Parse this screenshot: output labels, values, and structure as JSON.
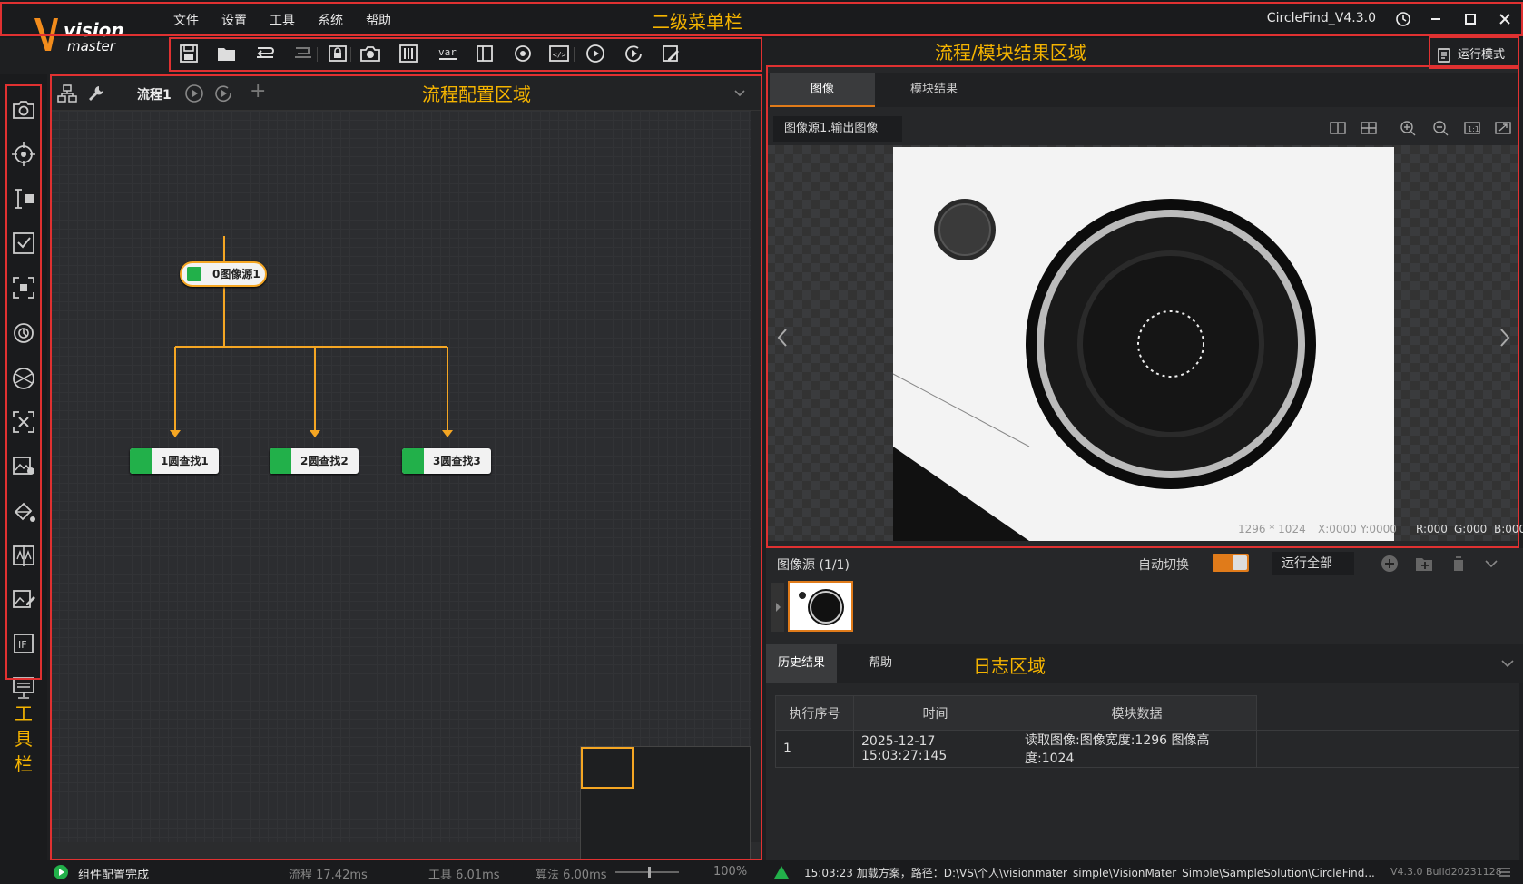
{
  "menu": [
    "文件",
    "设置",
    "工具",
    "系统",
    "帮助"
  ],
  "app_title": "CircleFind_V4.3.0",
  "annotations": {
    "secondary_menu": "二级菜单栏",
    "flow_result": "流程/模块结果区域",
    "flow_config": "流程配置区域",
    "log_area": "日志区域",
    "toolbar_label": "工\n具\n栏"
  },
  "run_mode": "运行模式",
  "flow": {
    "tab": "流程1",
    "nodes": [
      "0图像源1",
      "1圆查找1",
      "2圆查找2",
      "3圆查找3"
    ]
  },
  "result": {
    "tabs": [
      "图像",
      "模块结果"
    ],
    "image_select": "图像源1.输出图像",
    "pixel_info": {
      "size": "1296 * 1024",
      "xy": "X:0000  Y:0000",
      "r": "R:000",
      "g": "G:000",
      "b": "B:000"
    }
  },
  "image_source": {
    "title": "图像源 (1/1)",
    "auto_switch": "自动切换",
    "run_all": "运行全部"
  },
  "log": {
    "tabs": [
      "历史结果",
      "帮助"
    ],
    "columns": [
      "执行序号",
      "时间",
      "模块数据"
    ],
    "rows": [
      [
        "1",
        "2025-12-17 15:03:27:145",
        "读取图像:图像宽度:1296 图像高度:1024"
      ]
    ]
  },
  "status": {
    "left": "组件配置完成",
    "flow_time": "流程  17.42ms",
    "tool_time": "工具  6.01ms",
    "algo_time": "算法  6.00ms",
    "zoom": "100%",
    "message": "15:03:23  加载方案，路径：D:\\VS\\个人\\visionmater_simple\\VisionMater_Simple\\SampleSolution\\CircleFind...",
    "version": "V4.3.0 Build20231128"
  },
  "colors": {
    "accent": "#f5b400",
    "highlight": "#e03131",
    "node_green": "#22b04a",
    "toggle": "#e07b1a"
  }
}
